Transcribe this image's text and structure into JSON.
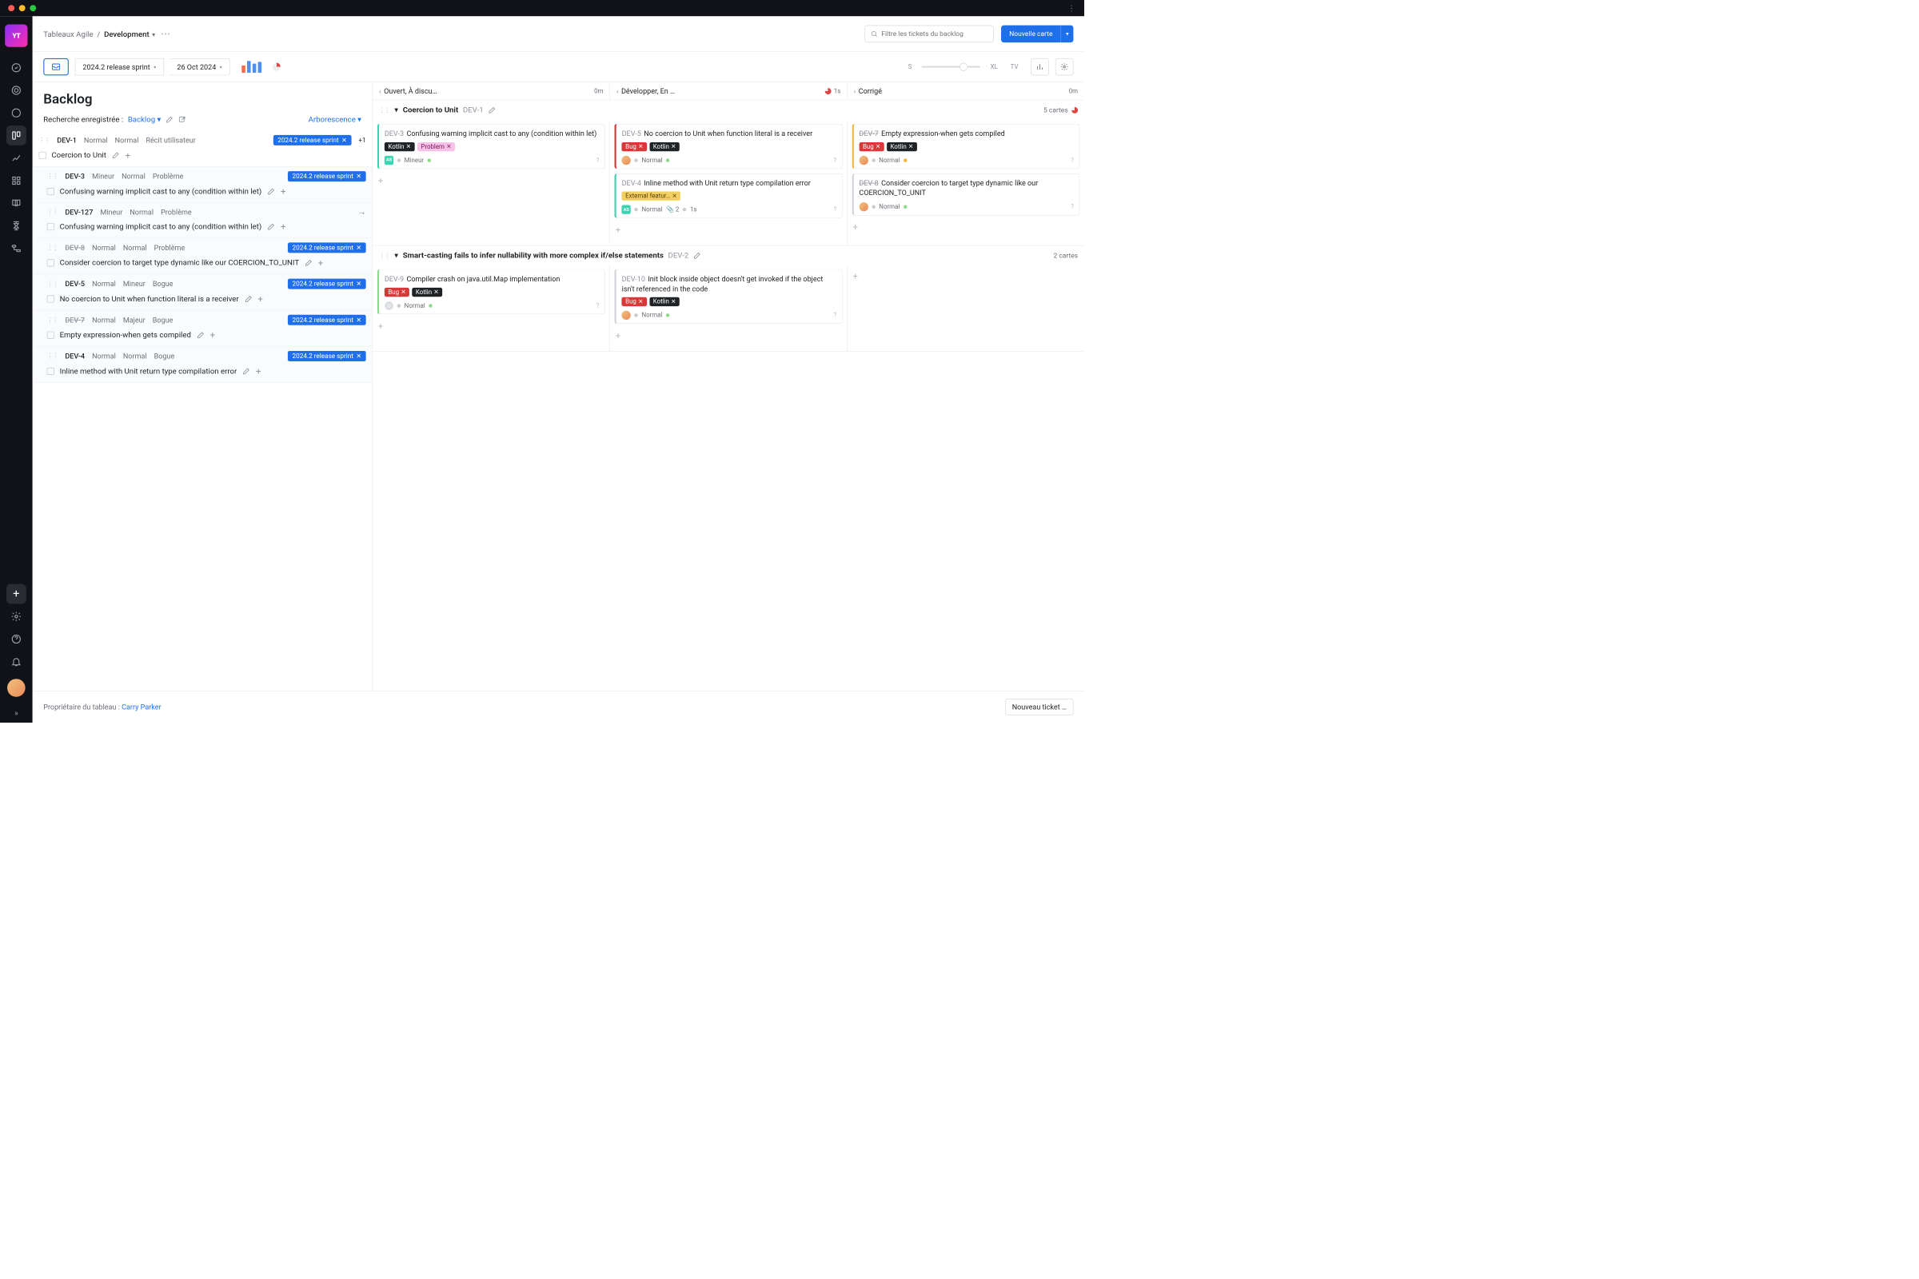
{
  "breadcrumb": {
    "root": "Tableaux Agile",
    "current": "Development"
  },
  "search": {
    "placeholder": "Filtre les tickets du backlog"
  },
  "buttons": {
    "new_card": "Nouvelle carte",
    "new_ticket": "Nouveau ticket …"
  },
  "toolbar": {
    "sprint": "2024.2 release sprint",
    "date": "26 Oct 2024",
    "size_s": "S",
    "size_xl": "XL",
    "tv": "TV"
  },
  "backlog": {
    "title": "Backlog",
    "saved_label": "Recherche enregistrée :",
    "saved_name": "Backlog",
    "display_mode": "Arborescence",
    "sprint_chip": "2024.2 release sprint",
    "plus_one": "+1",
    "items": [
      {
        "id": "DEV-1",
        "priority": "Normal",
        "severity": "Normal",
        "type": "Récit utilisateur",
        "title": "Coercion to Unit",
        "sprint": true,
        "struck": false,
        "top": true
      },
      {
        "id": "DEV-3",
        "priority": "Mineur",
        "severity": "Normal",
        "type": "Problème",
        "title": "Confusing warning implicit cast to any (condition within let)",
        "sprint": true,
        "child": true
      },
      {
        "id": "DEV-127",
        "priority": "Mineur",
        "severity": "Normal",
        "type": "Problème",
        "title": "Confusing warning implicit cast to any (condition within let)",
        "child": true,
        "arrow": true
      },
      {
        "id": "DEV-8",
        "priority": "Normal",
        "severity": "Normal",
        "type": "Problème",
        "title": "Consider coercion to target type dynamic like our COERCION_TO_UNIT",
        "sprint": true,
        "child": true,
        "struck": true
      },
      {
        "id": "DEV-5",
        "priority": "Normal",
        "severity": "Mineur",
        "type": "Bogue",
        "title": "No coercion to Unit when function literal is a receiver",
        "sprint": true,
        "child": true
      },
      {
        "id": "DEV-7",
        "priority": "Normal",
        "severity": "Majeur",
        "type": "Bogue",
        "title": "Empty expression-when gets compiled",
        "sprint": true,
        "child": true,
        "struck": true
      },
      {
        "id": "DEV-4",
        "priority": "Normal",
        "severity": "Normal",
        "type": "Bogue",
        "title": "Inline method with Unit return type compilation error",
        "sprint": true,
        "child": true
      }
    ]
  },
  "board": {
    "columns": [
      {
        "name": "Ouvert, À discu…",
        "time": "0m"
      },
      {
        "name": "Développer, En …",
        "time": "1s",
        "pie": true
      },
      {
        "name": "Corrigé",
        "time": "0m"
      }
    ],
    "swimlanes": [
      {
        "title": "Coercion to Unit",
        "id": "DEV-1",
        "count": "5 cartes",
        "pie": true,
        "cols": [
          [
            {
              "id": "DEV-3",
              "title": "Confusing warning implicit cast to any (condition within let)",
              "tags": [
                {
                  "t": "Kotlin",
                  "bg": "#1f2326",
                  "fg": "#fff"
                },
                {
                  "t": "Problem",
                  "bg": "#f8c2e8",
                  "fg": "#7a1457"
                }
              ],
              "border": "#3bd3b2",
              "av": "sq",
              "avText": "AS",
              "status": "Mineur",
              "dot": "#8fd98f"
            }
          ],
          [
            {
              "id": "DEV-5",
              "title": "No coercion to Unit when function literal is a receiver",
              "tags": [
                {
                  "t": "Bug",
                  "bg": "#d93838",
                  "fg": "#fff"
                },
                {
                  "t": "Kotlin",
                  "bg": "#1f2326",
                  "fg": "#fff"
                }
              ],
              "border": "#d93838",
              "av": "round",
              "status": "Normal",
              "dot": "#8fd98f"
            },
            {
              "id": "DEV-4",
              "title": "Inline method with Unit return type compilation error",
              "tags": [
                {
                  "t": "External featur…",
                  "bg": "#f2cf63",
                  "fg": "#5a4607"
                }
              ],
              "border": "#3bd3b2",
              "av": "sq",
              "avText": "AS",
              "status": "Normal",
              "dot": "#ccc",
              "attach": "2",
              "est": "1s"
            }
          ],
          [
            {
              "id": "DEV-7",
              "title": "Empty expression-when gets compiled",
              "tags": [
                {
                  "t": "Bug",
                  "bg": "#d93838",
                  "fg": "#fff"
                },
                {
                  "t": "Kotlin",
                  "bg": "#1f2326",
                  "fg": "#fff"
                }
              ],
              "border": "#f2b63a",
              "av": "round",
              "status": "Normal",
              "struck": true,
              "dot2": "#f2b63a"
            },
            {
              "id": "DEV-8",
              "title": "Consider coercion to target type dynamic like our COERCION_TO_UNIT",
              "tags": [],
              "border": "#d0d3d8",
              "av": "round",
              "status": "Normal",
              "struck": true,
              "dot": "#8fd98f"
            }
          ]
        ]
      },
      {
        "title": "Smart-casting fails to infer nullability with more complex if/else statements",
        "id": "DEV-2",
        "count": "2 cartes",
        "cols": [
          [
            {
              "id": "DEV-9",
              "title": "Compiler crash on java.util.Map implementation",
              "tags": [
                {
                  "t": "Bug",
                  "bg": "#d93838",
                  "fg": "#fff"
                },
                {
                  "t": "Kotlin",
                  "bg": "#1f2326",
                  "fg": "#fff"
                }
              ],
              "border": "#8fd98f",
              "av": "unset",
              "status": "Normal",
              "dot": "#8fd98f"
            }
          ],
          [
            {
              "id": "DEV-10",
              "title": "Init block inside object doesn't get invoked if the object isn't referenced in the code",
              "tags": [
                {
                  "t": "Bug",
                  "bg": "#d93838",
                  "fg": "#fff"
                },
                {
                  "t": "Kotlin",
                  "bg": "#1f2326",
                  "fg": "#fff"
                }
              ],
              "border": "#d0d3d8",
              "av": "round",
              "status": "Normal",
              "dot": "#8fd98f"
            }
          ],
          []
        ]
      }
    ]
  },
  "footer": {
    "owner_label": "Propriétaire du tableau :",
    "owner_name": "Carry Parker"
  }
}
